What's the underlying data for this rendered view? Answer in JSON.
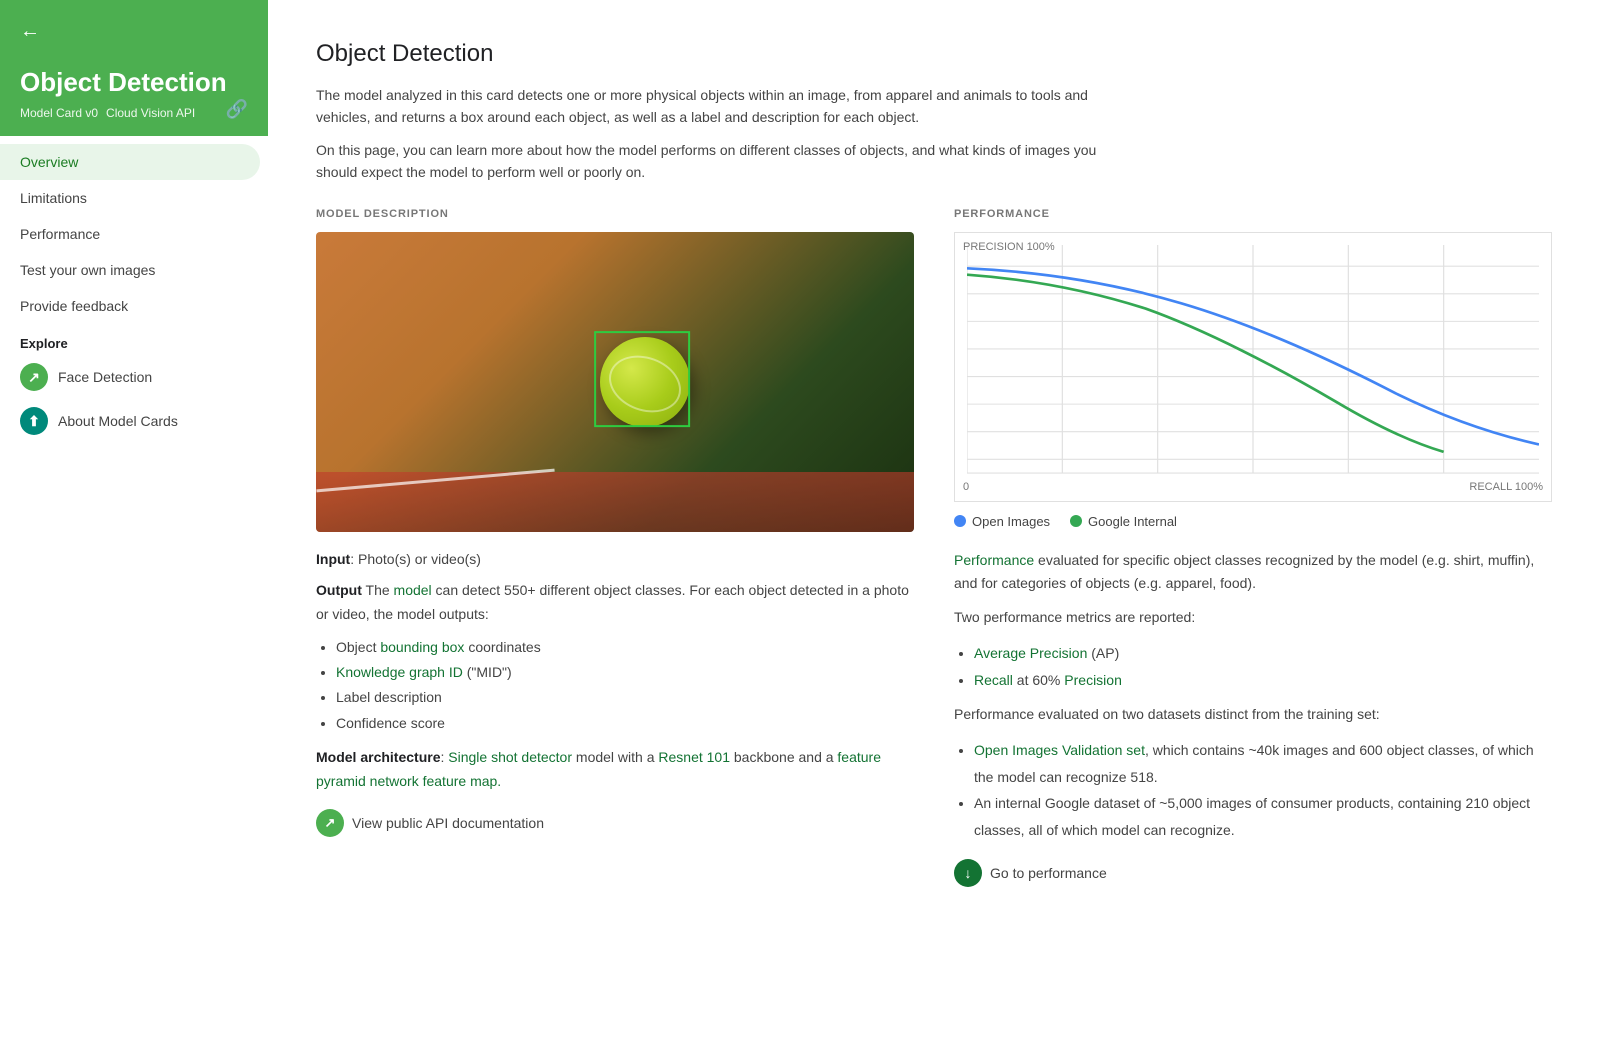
{
  "sidebar": {
    "back_arrow": "←",
    "title": "Object Detection",
    "subtitle_left": "Model Card v0",
    "subtitle_right": "Cloud Vision API",
    "link_icon": "🔗",
    "nav_items": [
      {
        "label": "Overview",
        "active": true
      },
      {
        "label": "Limitations",
        "active": false
      },
      {
        "label": "Performance",
        "active": false
      },
      {
        "label": "Test your own images",
        "active": false
      },
      {
        "label": "Provide feedback",
        "active": false
      }
    ],
    "explore_label": "Explore",
    "explore_items": [
      {
        "label": "Face Detection",
        "icon": "↗",
        "color": "green"
      },
      {
        "label": "About Model Cards",
        "icon": "⬆",
        "color": "teal"
      }
    ]
  },
  "main": {
    "page_title": "Object Detection",
    "intro_1": "The model analyzed in this card detects one or more physical objects within an image, from apparel and animals to tools and vehicles, and returns a box around each object, as well as a label and description for each object.",
    "intro_2": "On this page, you can learn more about how the model performs on different classes of objects, and what kinds of images you should expect the model to perform well or poorly on.",
    "model_desc_label": "MODEL DESCRIPTION",
    "input_text": ": Photo(s) or video(s)",
    "input_label": "Input",
    "output_label": "Output",
    "output_text": ": The",
    "output_model": "model",
    "output_rest": "can detect 550+ different object classes. For each object detected in a photo or video, the model outputs:",
    "bullets": [
      "Object bounding box coordinates",
      "Knowledge graph ID (\"MID\")",
      "Label description",
      "Confidence score"
    ],
    "arch_label": "Model architecture",
    "arch_text": ": ",
    "arch_link1": "Single shot detector",
    "arch_mid": " model with a ",
    "arch_link2": "Resnet 101",
    "arch_end": " backbone and a ",
    "arch_link3": "feature pyramid network feature map.",
    "api_doc_label": "View public API documentation",
    "perf_label": "PERFORMANCE",
    "chart_y_label": "PRECISION 100%",
    "chart_x_label": "RECALL 100%",
    "chart_x_zero": "0",
    "legend_open": "Open Images",
    "legend_google": "Google Internal",
    "perf_intro": " evaluated for specific object classes recognized by the model (e.g. shirt, muffin), and for categories of objects (e.g. apparel, food).",
    "perf_intro_link": "Performance",
    "perf_two_metrics": "Two performance metrics are reported:",
    "perf_metrics": [
      "Average Precision (AP)",
      "Recall at 60% Precision"
    ],
    "perf_datasets_text": "Performance evaluated on two datasets distinct from the training set:",
    "perf_dataset_bullets": [
      "Open Images Validation set, which contains ~40k images and 600 object classes, of which the model can recognize 518.",
      "An internal Google dataset of ~5,000 images of consumer products, containing 210 object classes, all of which model can recognize."
    ],
    "goto_perf_label": "Go to performance"
  }
}
